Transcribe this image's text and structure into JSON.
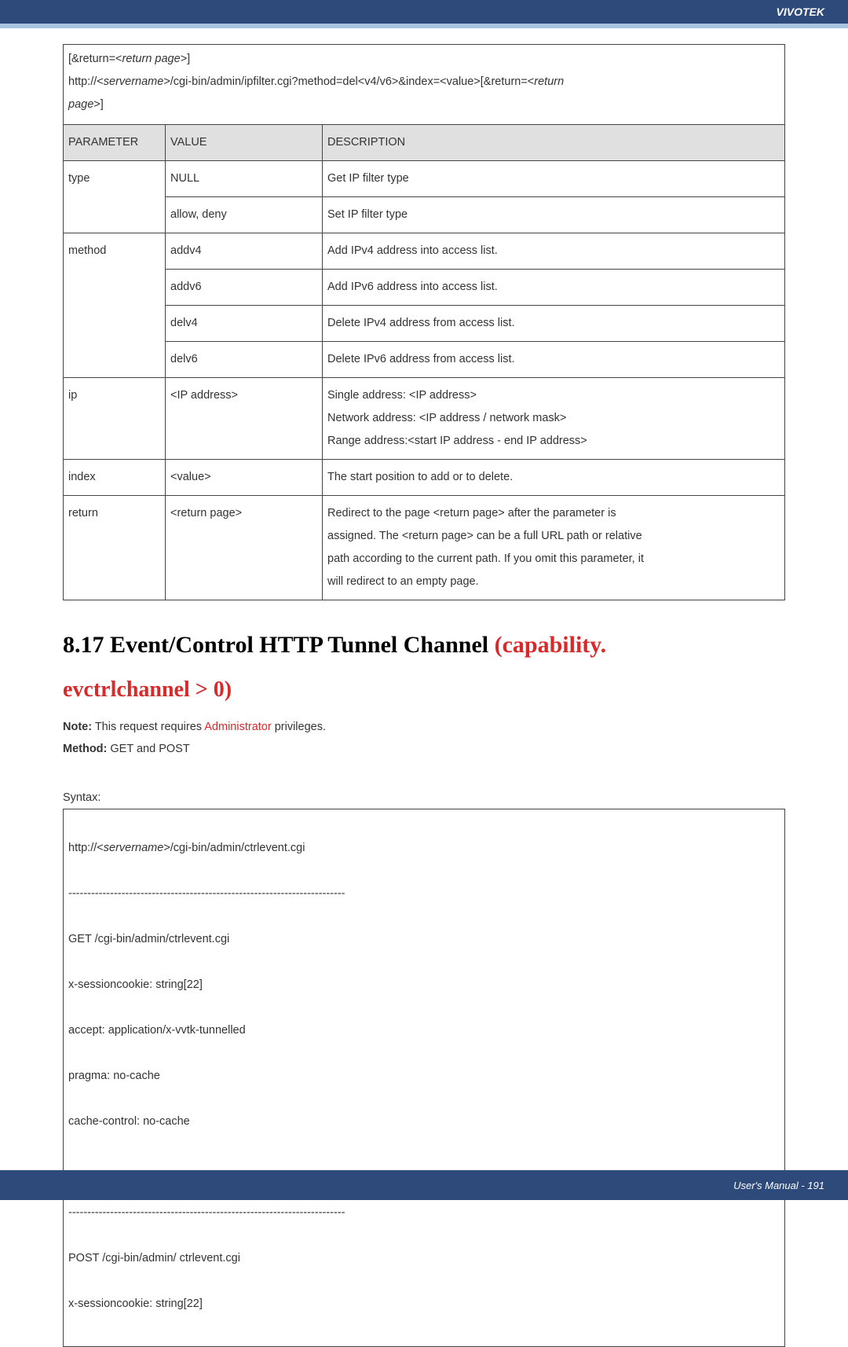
{
  "brand": "VIVOTEK",
  "intro": {
    "line1_a": "[&return=<",
    "line1_i": "return page",
    "line1_b": ">]",
    "line2_a": "http://<",
    "line2_i": "servername",
    "line2_b": ">/cgi-bin/admin/ipfilter.cgi?method=del<v4/v6>&index=<value>[&return=<",
    "line2_c": "return",
    "line3_i": "page",
    "line3_b": ">]"
  },
  "table": {
    "headers": {
      "param": "PARAMETER",
      "value": "VALUE",
      "desc": "DESCRIPTION"
    },
    "type": {
      "param": "type",
      "v1": "NULL",
      "d1": "Get IP filter type",
      "v2": "allow, deny",
      "d2": "Set IP filter type"
    },
    "method": {
      "param": "method",
      "v1": "addv4",
      "d1": "Add IPv4 address into access list.",
      "v2": "addv6",
      "d2": "Add IPv6 address into access list.",
      "v3": "delv4",
      "d3": "Delete IPv4 address from access list.",
      "v4": "delv6",
      "d4": "Delete IPv6 address from access list."
    },
    "ip": {
      "param": "ip",
      "v": "<IP address>",
      "d1": "Single address: <IP address>",
      "d2": "Network address: <IP address / network mask>",
      "d3": "Range address:<start IP address - end IP address>"
    },
    "index": {
      "param": "index",
      "v": "<value>",
      "d": "The start position to add or to delete."
    },
    "return": {
      "param": "return",
      "v": "<return page>",
      "d1a": "Redirect to the page ",
      "d1i": "<return page>",
      "d1b": " after the parameter is",
      "d2a": "assigned. The ",
      "d2i": "<return page>",
      "d2b": " can be a full URL path or relative",
      "d3": "path according to the current path. If you omit this parameter, it",
      "d4": "will redirect to an empty page."
    }
  },
  "heading": {
    "black": "8.17 Event/Control HTTP Tunnel Channel ",
    "red1": "(capability.",
    "red2": "evctrlchannel > 0)"
  },
  "note": {
    "note_label": "Note:",
    "note_a": " This request requires ",
    "note_red": "Administrator",
    "note_b": " privileges.",
    "method_label": "Method:",
    "method_text": " GET and POST"
  },
  "syntax_label": "Syntax:",
  "syntax": {
    "l1a": "http://<",
    "l1i": "servername",
    "l1b": ">/cgi-bin/admin/ctrlevent.cgi",
    "sep": "-------------------------------------------------------------------------",
    "l2": "GET /cgi-bin/admin/ctrlevent.cgi",
    "l3": "x-sessioncookie: string[22]",
    "l4": "accept: application/x-vvtk-tunnelled",
    "l5": "pragma: no-cache",
    "l6": "cache-control: no-cache",
    "l7": "POST /cgi-bin/admin/ ctrlevent.cgi",
    "l8": "x-sessioncookie: string[22]"
  },
  "footer": "User's Manual - 191"
}
